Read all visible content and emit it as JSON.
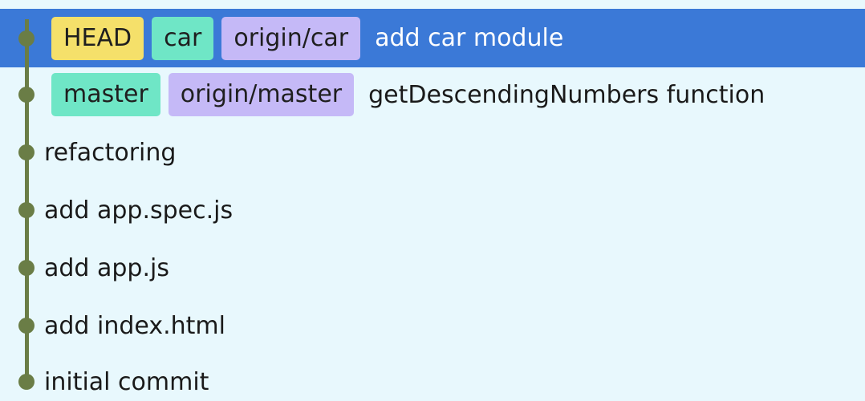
{
  "commits": [
    {
      "refs": [
        {
          "label": "HEAD",
          "kind": "head"
        },
        {
          "label": "car",
          "kind": "local"
        },
        {
          "label": "origin/car",
          "kind": "remote"
        }
      ],
      "message": "add car module",
      "selected": true
    },
    {
      "refs": [
        {
          "label": "master",
          "kind": "local"
        },
        {
          "label": "origin/master",
          "kind": "remote"
        }
      ],
      "message": "getDescendingNumbers function",
      "selected": false
    },
    {
      "refs": [],
      "message": "refactoring",
      "selected": false
    },
    {
      "refs": [],
      "message": "add app.spec.js",
      "selected": false
    },
    {
      "refs": [],
      "message": "add app.js",
      "selected": false
    },
    {
      "refs": [],
      "message": "add index.html",
      "selected": false
    },
    {
      "refs": [],
      "message": "initial commit",
      "selected": false
    }
  ],
  "colors": {
    "background": "#e8f8fd",
    "selected_row": "#3b79d7",
    "graph_line": "#6a7d46",
    "head_badge": "#f5e06a",
    "local_branch_badge": "#6fe6c6",
    "remote_branch_badge": "#c5b9f7"
  }
}
